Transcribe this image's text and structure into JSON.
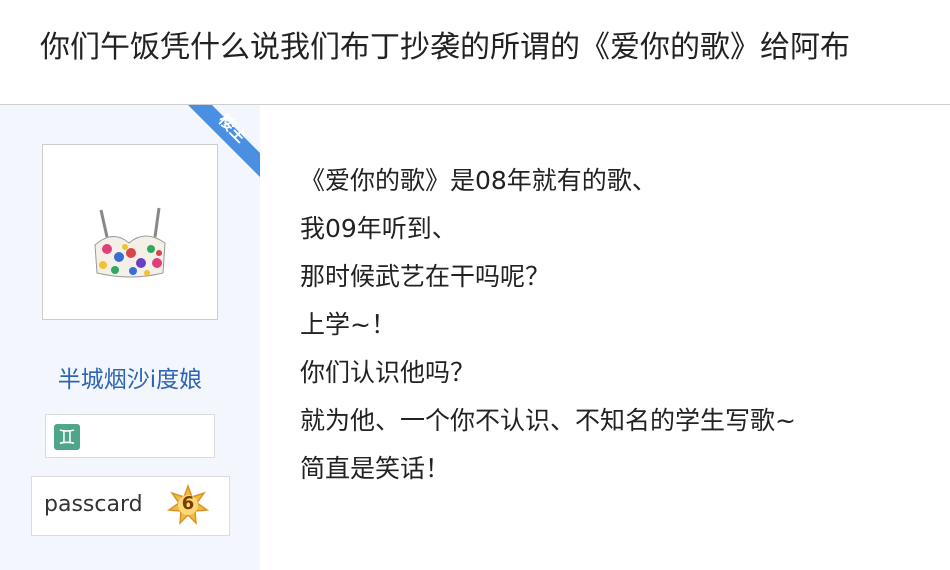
{
  "thread": {
    "title": "你们午饭凭什么说我们布丁抄袭的所谓的《爱你的歌》给阿布"
  },
  "author": {
    "avatar": "avatar-floral-bra-image",
    "username": "半城烟沙i度娘",
    "zodiac_icon": "gemini-icon",
    "zodiac_glyph": "♊",
    "passcard_label": "passcard",
    "level": "6",
    "louzhu_label": "楼主",
    "colors": {
      "username": "#2d64b3",
      "sidebar_bg": "#f3f7fd",
      "louzhu_corner": "#4a90e2",
      "level_badge": "#f3b93a"
    }
  },
  "post": {
    "lines": [
      "《爱你的歌》是08年就有的歌、",
      "我09年听到、",
      "那时候武艺在干吗呢？",
      "上学~！",
      "你们认识他吗？",
      "就为他、一个你不认识、不知名的学生写歌~",
      "简直是笑话！"
    ]
  }
}
